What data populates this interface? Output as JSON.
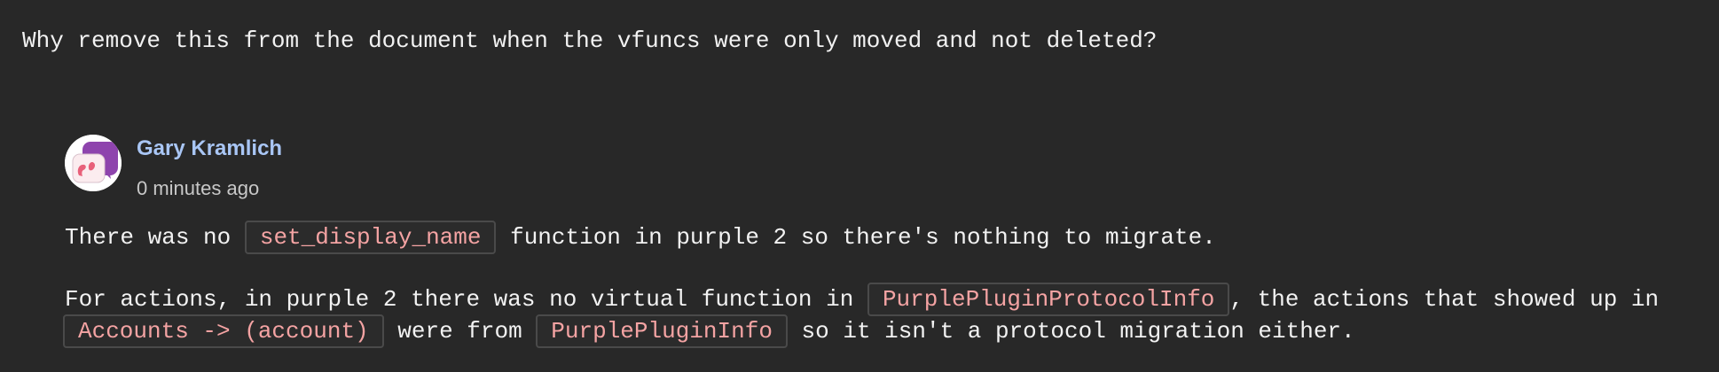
{
  "question": "Why remove this from the document when the vfuncs were only moved and not deleted?",
  "comment": {
    "author": "Gary Kramlich",
    "timestamp": "0 minutes ago",
    "paragraph1": {
      "pre": "There was no ",
      "code": "set_display_name",
      "post": " function in purple 2 so there's nothing to migrate."
    },
    "paragraph2": {
      "pre": "For actions, in purple 2 there was no virtual function in ",
      "code1": "PurplePluginProtocolInfo",
      "mid1": ", the actions that showed up in",
      "code2": "Accounts -> (account)",
      "mid2": " were from ",
      "code3": "PurplePluginInfo",
      "post": " so it isn't a protocol migration either."
    }
  },
  "colors": {
    "background": "#282828",
    "author": "#a9c6f5",
    "code_text": "#f4a3a3",
    "avatar_purple": "#8e44ad",
    "avatar_pink": "#e8607a"
  },
  "icons": {
    "avatar": "pidgin-logo-avatar"
  }
}
